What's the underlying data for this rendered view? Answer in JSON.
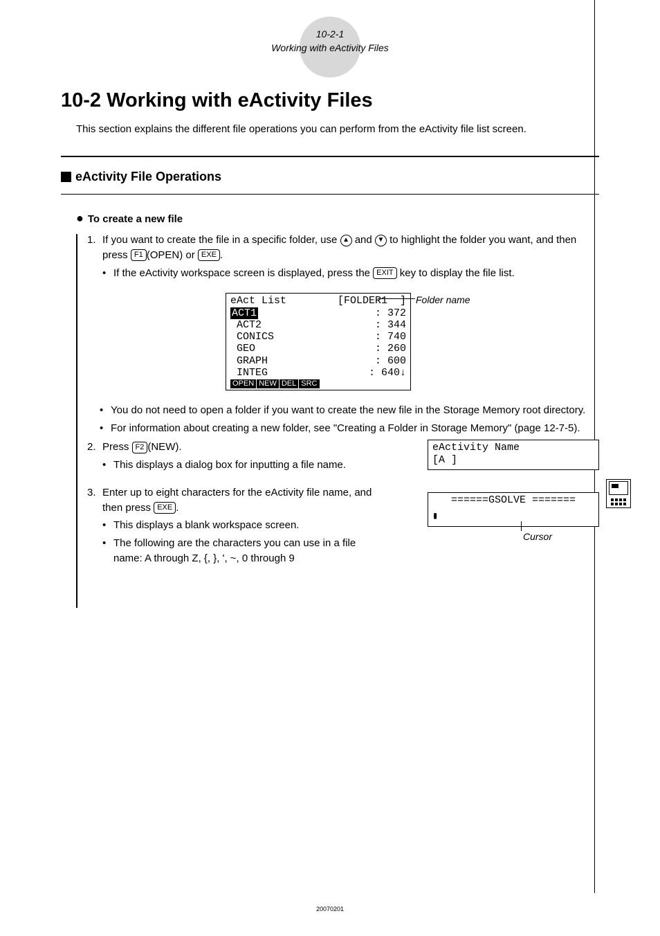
{
  "header": {
    "page_num": "10-2-1",
    "subtitle": "Working with eActivity Files"
  },
  "title": "10-2  Working with eActivity Files",
  "intro": "This section explains the different file operations you can perform from the eActivity file list screen.",
  "section_heading": "eActivity File Operations",
  "subsection": "To create a new file",
  "steps": {
    "s1_pre": "1.",
    "s1_text_a": "If you want to create the file in a specific folder, use ",
    "s1_text_b": " and ",
    "s1_text_c": " to highlight the folder you want, and then press ",
    "s1_key_f1": "F1",
    "s1_open": "(OPEN) or ",
    "s1_key_exe": "EXE",
    "s1_period": ".",
    "s1_bullet1_a": "If the eActivity workspace screen is displayed, press the ",
    "s1_key_exit": "EXIT",
    "s1_bullet1_b": " key to display the file list.",
    "s1_bullet2": "You do not need to open a folder if you want to create the new file in the Storage Memory root directory.",
    "s1_bullet3": "For information about creating a new folder, see \"Creating a Folder in Storage Memory\" (page 12-7-5).",
    "s2_pre": "2.",
    "s2_text_a": "Press ",
    "s2_key_f2": "F2",
    "s2_text_b": "(NEW).",
    "s2_bullet": "This displays a dialog box for inputting a file name.",
    "s3_pre": "3.",
    "s3_text_a": "Enter up to eight characters for the eActivity file name, and then press ",
    "s3_key_exe": "EXE",
    "s3_period": ".",
    "s3_bullet1": "This displays a blank workspace screen.",
    "s3_bullet2": "The following are the characters you can use in a file name: A through Z, {, }, ', ~, 0 through 9"
  },
  "lcd_main": {
    "title_left": "eAct List",
    "title_right": "[FOLDER1  ]",
    "rows": [
      {
        "name": "ACT1",
        "size": "372"
      },
      {
        "name": "ACT2",
        "size": "344"
      },
      {
        "name": "CONICS",
        "size": "740"
      },
      {
        "name": "GEO",
        "size": "260"
      },
      {
        "name": "GRAPH",
        "size": "600"
      },
      {
        "name": "INTEG",
        "size": "640↓"
      }
    ],
    "footer": [
      "OPEN",
      "NEW",
      "DEL",
      "SRC"
    ]
  },
  "folder_label": "Folder name",
  "lcd_name_dialog": {
    "line1": "eActivity Name",
    "line2": "[A       ]"
  },
  "lcd_workspace": {
    "title": "======GSOLVE  =======",
    "cursor": "▮"
  },
  "cursor_label": "Cursor",
  "footer": "20070201"
}
